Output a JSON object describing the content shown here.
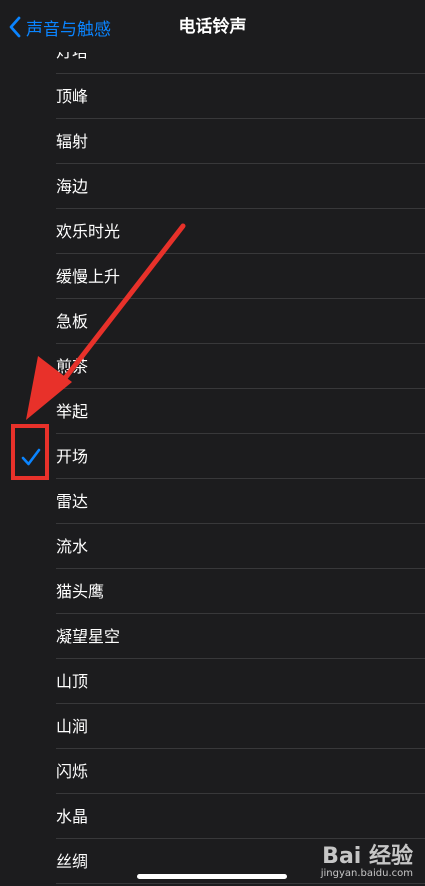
{
  "nav": {
    "back_label": "声音与触感",
    "title": "电话铃声"
  },
  "ringtones": [
    {
      "name": "灯塔",
      "selected": false
    },
    {
      "name": "顶峰",
      "selected": false
    },
    {
      "name": "辐射",
      "selected": false
    },
    {
      "name": "海边",
      "selected": false
    },
    {
      "name": "欢乐时光",
      "selected": false
    },
    {
      "name": "缓慢上升",
      "selected": false
    },
    {
      "name": "急板",
      "selected": false
    },
    {
      "name": "煎茶",
      "selected": false
    },
    {
      "name": "举起",
      "selected": false
    },
    {
      "name": "开场",
      "selected": true
    },
    {
      "name": "雷达",
      "selected": false
    },
    {
      "name": "流水",
      "selected": false
    },
    {
      "name": "猫头鹰",
      "selected": false
    },
    {
      "name": "凝望星空",
      "selected": false
    },
    {
      "name": "山顶",
      "selected": false
    },
    {
      "name": "山涧",
      "selected": false
    },
    {
      "name": "闪烁",
      "selected": false
    },
    {
      "name": "水晶",
      "selected": false
    },
    {
      "name": "丝绸",
      "selected": false
    }
  ],
  "colors": {
    "accent": "#0a84ff",
    "background": "#1c1c1e",
    "separator": "#38383a",
    "annotation": "#e8312a"
  },
  "icons": {
    "back": "chevron-left-icon",
    "selected": "checkmark-icon"
  },
  "watermark": {
    "brand": "Bai 经验",
    "url": "jingyan.baidu.com"
  }
}
